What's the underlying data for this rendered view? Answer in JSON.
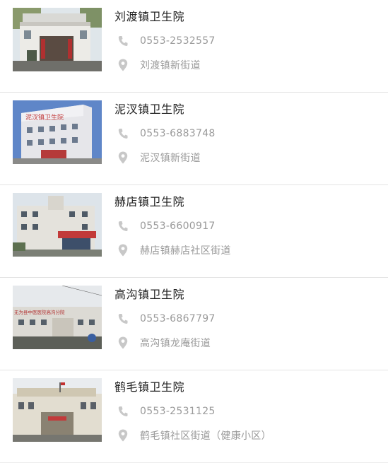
{
  "colors": {
    "name_text": "#222222",
    "detail_text": "#9a9a9a",
    "icon_gray": "#c8c8c8",
    "divider": "#e3e3e3"
  },
  "icons": {
    "phone": "phone-icon",
    "location": "location-pin-icon"
  },
  "items": [
    {
      "name": "刘渡镇卫生院",
      "phone": "0553-2532557",
      "address": "刘渡镇新街道",
      "photo": "building-photo"
    },
    {
      "name": "泥汊镇卫生院",
      "phone": "0553-6883748",
      "address": "泥汊镇新街道",
      "photo": "building-photo",
      "photo_sign": "泥汊镇卫生院"
    },
    {
      "name": "赫店镇卫生院",
      "phone": "0553-6600917",
      "address": "赫店镇赫店社区街道",
      "photo": "building-photo"
    },
    {
      "name": "高沟镇卫生院",
      "phone": "0553-6867797",
      "address": "高沟镇龙庵街道",
      "photo": "building-photo",
      "photo_sign": "无为县中医医院高沟分院"
    },
    {
      "name": "鹤毛镇卫生院",
      "phone": "0553-2531125",
      "address": "鹤毛镇社区街道（健康小区）",
      "photo": "building-photo"
    }
  ]
}
